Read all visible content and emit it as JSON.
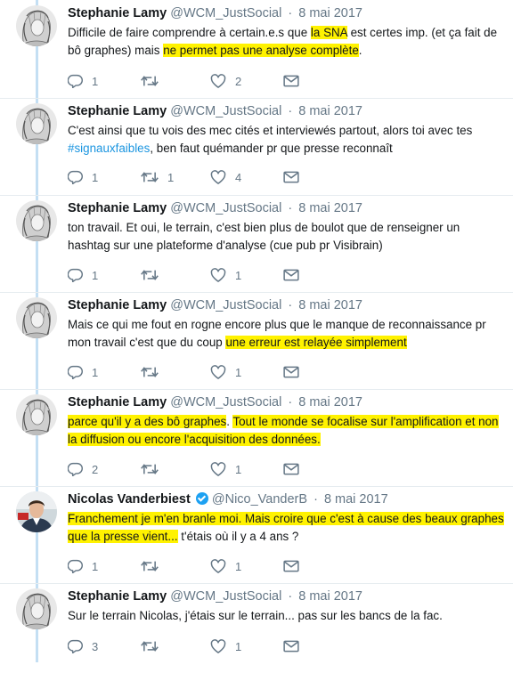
{
  "tweets": [
    {
      "name": "Stephanie Lamy",
      "handle": "@WCM_JustSocial",
      "date": "8 mai 2017",
      "verified": false,
      "text_segments": [
        {
          "t": "Difficile de faire comprendre à certain.e.s que ",
          "hl": false
        },
        {
          "t": "la SNA",
          "hl": true
        },
        {
          "t": " est certes imp. (et ça fait de bô graphes) mais ",
          "hl": false
        },
        {
          "t": "ne permet pas une analyse complète",
          "hl": true
        },
        {
          "t": ".",
          "hl": false
        }
      ],
      "replies": "1",
      "retweets": "",
      "likes": "2"
    },
    {
      "name": "Stephanie Lamy",
      "handle": "@WCM_JustSocial",
      "date": "8 mai 2017",
      "verified": false,
      "text_segments": [
        {
          "t": "C'est ainsi que tu vois des mec cités et interviewés partout, alors toi avec tes ",
          "hl": false
        },
        {
          "t": "#signauxfaibles",
          "tag": true
        },
        {
          "t": ", ben faut quémander pr que presse reconnaît",
          "hl": false
        }
      ],
      "replies": "1",
      "retweets": "1",
      "likes": "4"
    },
    {
      "name": "Stephanie Lamy",
      "handle": "@WCM_JustSocial",
      "date": "8 mai 2017",
      "verified": false,
      "text_segments": [
        {
          "t": "ton travail. Et oui, le terrain, c'est bien plus de boulot que de renseigner un hashtag sur une plateforme d'analyse (cue pub pr Visibrain)",
          "hl": false
        }
      ],
      "replies": "1",
      "retweets": "",
      "likes": "1"
    },
    {
      "name": "Stephanie Lamy",
      "handle": "@WCM_JustSocial",
      "date": "8 mai 2017",
      "verified": false,
      "text_segments": [
        {
          "t": "Mais ce qui me fout en rogne encore plus que le manque de reconnaissance pr mon travail c'est que du coup ",
          "hl": false
        },
        {
          "t": "une erreur est relayée simplement",
          "hl": true
        }
      ],
      "replies": "1",
      "retweets": "",
      "likes": "1"
    },
    {
      "name": "Stephanie Lamy",
      "handle": "@WCM_JustSocial",
      "date": "8 mai 2017",
      "verified": false,
      "text_segments": [
        {
          "t": "parce qu'il y a des bô graphes",
          "hl": true
        },
        {
          "t": ". ",
          "hl": false
        },
        {
          "t": "Tout le monde se focalise sur l'amplification et non la diffusion ou encore l'acquisition des données.",
          "hl": true
        }
      ],
      "replies": "2",
      "retweets": "",
      "likes": "1"
    },
    {
      "name": "Nicolas Vanderbiest",
      "handle": "@Nico_VanderB",
      "date": "8 mai 2017",
      "verified": true,
      "text_segments": [
        {
          "t": "Franchement je m'en branle moi. Mais croire que c'est à cause des beaux graphes que la presse vient...",
          "hl": true
        },
        {
          "t": " t'étais où il y a 4 ans ?",
          "hl": false
        }
      ],
      "replies": "1",
      "retweets": "",
      "likes": "1"
    },
    {
      "name": "Stephanie Lamy",
      "handle": "@WCM_JustSocial",
      "date": "8 mai 2017",
      "verified": false,
      "text_segments": [
        {
          "t": "Sur le terrain Nicolas, j'étais sur le terrain... pas sur les bancs de la fac.",
          "hl": false
        }
      ],
      "replies": "3",
      "retweets": "",
      "likes": "1"
    }
  ],
  "separator": "·",
  "colors": {
    "highlight": "#fff200",
    "thread_line": "#c4dff3",
    "hashtag": "#1b95e0",
    "muted": "#657786",
    "verified": "#1da1f2"
  },
  "icons": {
    "reply": "reply-icon",
    "retweet": "retweet-icon",
    "like": "heart-icon",
    "message": "envelope-icon"
  }
}
